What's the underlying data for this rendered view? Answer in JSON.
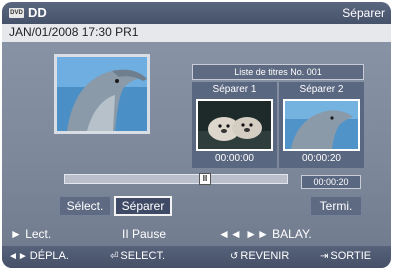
{
  "header": {
    "disc_badge": "DVD",
    "title": "DD",
    "mode": "Séparer"
  },
  "info": {
    "datetime": "JAN/01/2008 17:30 PR1"
  },
  "title_list": {
    "heading": "Liste de titres No. 001",
    "panels": [
      {
        "label": "Séparer 1",
        "time": "00:00:00"
      },
      {
        "label": "Séparer 2",
        "time": "00:00:20"
      }
    ]
  },
  "timeline": {
    "current_time": "00:00:20",
    "play_icon": "pause-icon",
    "position": 0.64
  },
  "buttons": {
    "select": "Sélect.",
    "split": "Séparer",
    "done": "Termi."
  },
  "help": {
    "play": "► Lect.",
    "pause": "II Pause",
    "scan": "◄◄ ►► BALAY."
  },
  "nav": {
    "move": "DÉPLA.",
    "select": "SELECT.",
    "return": "REVENIR",
    "exit": "SORTIE"
  },
  "colors": {
    "background": "#7d889b",
    "title_bar": "#46516a",
    "panel": "#5a6780"
  }
}
